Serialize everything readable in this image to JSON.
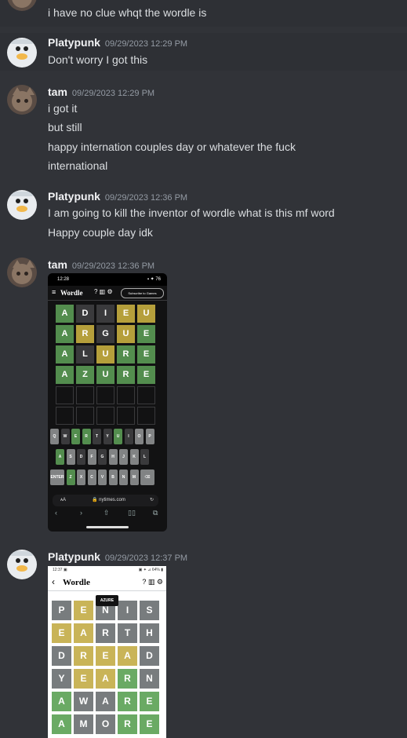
{
  "messages": [
    {
      "id": "m0",
      "lines": [
        "i have no clue whqt the wordle is"
      ]
    },
    {
      "id": "m1",
      "author": "Platypunk",
      "timestamp": "09/29/2023 12:29 PM",
      "lines": [
        "Don't worry I got this"
      ]
    },
    {
      "id": "m2",
      "author": "tam",
      "timestamp": "09/29/2023 12:29 PM",
      "lines": [
        "i got it",
        "but still",
        "happy internation couples day or whatever the fuck",
        "international"
      ]
    },
    {
      "id": "m3",
      "author": "Platypunk",
      "timestamp": "09/29/2023 12:36 PM",
      "lines": [
        "I am going to kill the inventor of wordle what is this mf word",
        "Happy couple day idk"
      ]
    },
    {
      "id": "m4",
      "author": "tam",
      "timestamp": "09/29/2023 12:36 PM"
    },
    {
      "id": "m5",
      "author": "Platypunk",
      "timestamp": "09/29/2023 12:37 PM"
    }
  ],
  "screenshot1": {
    "status_time": "12:28",
    "status_right": "▪ ✦ 76",
    "menu_icon": "≡",
    "title": "Wordle",
    "header_icons": "? ▥ ⚙",
    "subscribe": "Subscribe to Games",
    "rows": [
      {
        "letters": [
          "A",
          "D",
          "I",
          "E",
          "U"
        ],
        "colors": [
          "g",
          "x",
          "x",
          "y",
          "y"
        ]
      },
      {
        "letters": [
          "A",
          "R",
          "G",
          "U",
          "E"
        ],
        "colors": [
          "g",
          "y",
          "x",
          "y",
          "g"
        ]
      },
      {
        "letters": [
          "A",
          "L",
          "U",
          "R",
          "E"
        ],
        "colors": [
          "g",
          "x",
          "y",
          "g",
          "g"
        ]
      },
      {
        "letters": [
          "A",
          "Z",
          "U",
          "R",
          "E"
        ],
        "colors": [
          "g",
          "g",
          "g",
          "g",
          "g"
        ]
      },
      {
        "letters": [
          "",
          "",
          "",
          "",
          ""
        ],
        "colors": [
          "e",
          "e",
          "e",
          "e",
          "e"
        ]
      },
      {
        "letters": [
          "",
          "",
          "",
          "",
          ""
        ],
        "colors": [
          "e",
          "e",
          "e",
          "e",
          "e"
        ]
      }
    ],
    "keyboard": [
      {
        "keys": [
          "Q",
          "W",
          "E",
          "R",
          "T",
          "Y",
          "U",
          "I",
          "O",
          "P"
        ],
        "colors": [
          "kg",
          "kd",
          "kgr",
          "kgr",
          "kd",
          "kd",
          "kgr",
          "kd",
          "kg",
          "kg"
        ]
      },
      {
        "keys": [
          "A",
          "S",
          "D",
          "F",
          "G",
          "H",
          "J",
          "K",
          "L"
        ],
        "colors": [
          "kgr",
          "kg",
          "kd",
          "kg",
          "kd",
          "kg",
          "kg",
          "kg",
          "kd"
        ]
      },
      {
        "keys": [
          "ENTER",
          "Z",
          "X",
          "C",
          "V",
          "B",
          "N",
          "M",
          "⌫"
        ],
        "colors": [
          "kg",
          "kgr",
          "kg",
          "kg",
          "kg",
          "kg",
          "kg",
          "kg",
          "kg"
        ]
      }
    ],
    "url_aa": "ᴀA",
    "url": "🔒 nytimes.com",
    "reload": "↻",
    "nav": [
      "‹",
      "›",
      "⇧",
      "▯▯",
      "⧉"
    ]
  },
  "screenshot2": {
    "status_time": "12:37 ▣",
    "status_right": "▣ ✦ ⊿ 64% ▮",
    "back": "‹",
    "title": "Wordle",
    "header_icons": "? ▥ ⚙",
    "toast": "AZURE",
    "rows": [
      {
        "letters": [
          "P",
          "E",
          "N",
          "I",
          "S"
        ],
        "colors": [
          "x2",
          "y2",
          "x2",
          "x2",
          "x2"
        ]
      },
      {
        "letters": [
          "E",
          "A",
          "R",
          "T",
          "H"
        ],
        "colors": [
          "y2",
          "y2",
          "x2",
          "x2",
          "x2"
        ]
      },
      {
        "letters": [
          "D",
          "R",
          "E",
          "A",
          "D"
        ],
        "colors": [
          "x2",
          "y2",
          "y2",
          "y2",
          "x2"
        ]
      },
      {
        "letters": [
          "Y",
          "E",
          "A",
          "R",
          "N"
        ],
        "colors": [
          "x2",
          "y2",
          "y2",
          "g2",
          "x2"
        ]
      },
      {
        "letters": [
          "A",
          "W",
          "A",
          "R",
          "E"
        ],
        "colors": [
          "g2",
          "x2",
          "x2",
          "g2",
          "g2"
        ]
      },
      {
        "letters": [
          "A",
          "M",
          "O",
          "R",
          "E"
        ],
        "colors": [
          "g2",
          "x2",
          "x2",
          "g2",
          "g2"
        ]
      }
    ]
  }
}
